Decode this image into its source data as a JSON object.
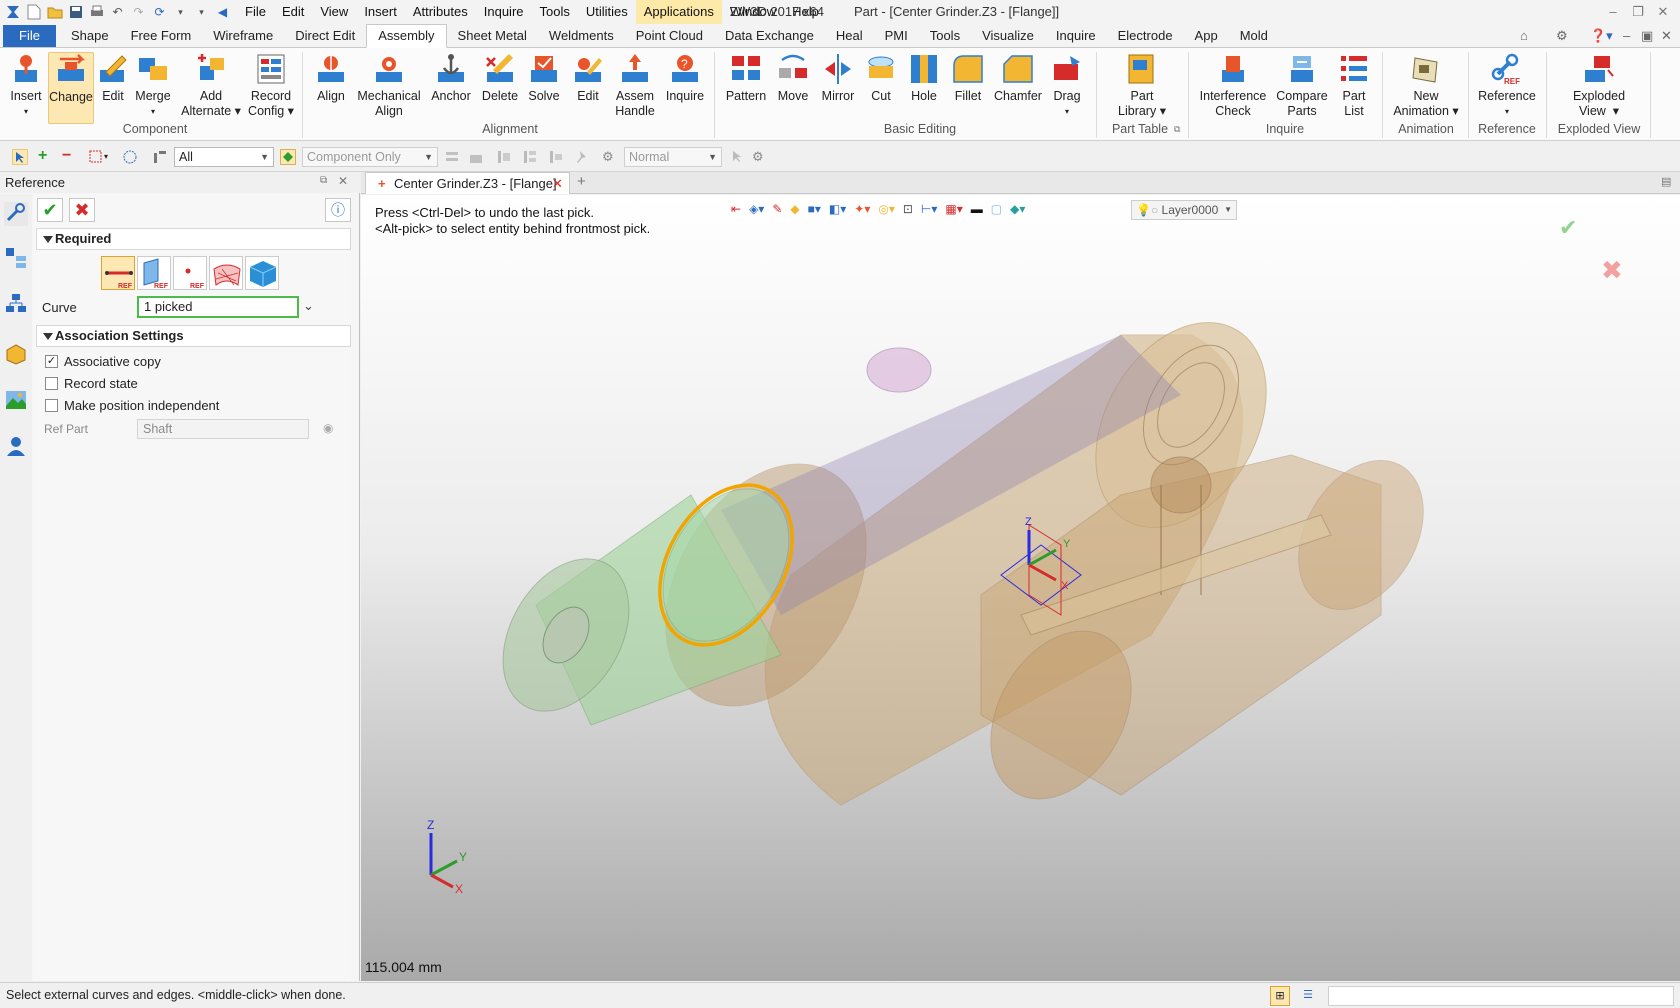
{
  "menu": [
    "File",
    "Edit",
    "View",
    "Insert",
    "Attributes",
    "Inquire",
    "Tools",
    "Utilities",
    "Applications",
    "Window",
    "Help"
  ],
  "window_title": {
    "app": "ZW3D 2017  x64",
    "doc": "Part - [Center Grinder.Z3 - [Flange]]"
  },
  "ribbon_tabs": [
    "Shape",
    "Free Form",
    "Wireframe",
    "Direct Edit",
    "Assembly",
    "Sheet Metal",
    "Weldments",
    "Point Cloud",
    "Data Exchange",
    "Heal",
    "PMI",
    "Tools",
    "Visualize",
    "Inquire",
    "Electrode",
    "App",
    "Mold"
  ],
  "file_tab": "File",
  "ribbon": {
    "component": {
      "group": "Component",
      "insert": "Insert",
      "change": "Change",
      "edit": "Edit",
      "merge": "Merge",
      "add_alt_1": "Add",
      "add_alt_2": "Alternate",
      "record_1": "Record",
      "record_2": "Config"
    },
    "alignment": {
      "group": "Alignment",
      "align": "Align",
      "mech_1": "Mechanical",
      "mech_2": "Align",
      "anchor": "Anchor",
      "delete": "Delete",
      "solve": "Solve",
      "edit": "Edit",
      "assem_1": "Assem",
      "assem_2": "Handle",
      "inquire": "Inquire"
    },
    "basic": {
      "group": "Basic Editing",
      "pattern": "Pattern",
      "move": "Move",
      "mirror": "Mirror",
      "cut": "Cut",
      "hole": "Hole",
      "fillet": "Fillet",
      "chamfer": "Chamfer",
      "drag": "Drag"
    },
    "parttable": {
      "group": "Part Table",
      "lib_1": "Part",
      "lib_2": "Library"
    },
    "inquire": {
      "group": "Inquire",
      "inter_1": "Interference",
      "inter_2": "Check",
      "comp_1": "Compare",
      "comp_2": "Parts",
      "list_1": "Part",
      "list_2": "List"
    },
    "animation": {
      "group": "Animation",
      "new_1": "New",
      "new_2": "Animation"
    },
    "reference": {
      "group": "Reference",
      "ref": "Reference"
    },
    "exploded": {
      "group": "Exploded View",
      "exp_1": "Exploded",
      "exp_2": "View"
    }
  },
  "toolbar": {
    "filter": "All",
    "scope": "Component Only",
    "mode": "Normal"
  },
  "panel": {
    "title": "Reference",
    "required": "Required",
    "curve_label": "Curve",
    "curve_value": "1 picked",
    "assoc": "Association Settings",
    "assoc_copy": "Associative copy",
    "record_state": "Record state",
    "pos_indep": "Make position independent",
    "ref_part_label": "Ref Part",
    "ref_part_value": "Shaft",
    "ref_badge": "REF"
  },
  "doc_tab": "Center Grinder.Z3 - [Flange]",
  "viewport": {
    "hint1": "Press <Ctrl-Del> to undo the last pick.",
    "hint2": "<Alt-pick> to select entity behind frontmost pick.",
    "layer": "Layer0000",
    "measure": "115.004 mm",
    "axis_x": "X",
    "axis_y": "Y",
    "axis_z": "Z"
  },
  "status": "Select external curves and edges.  <middle-click> when done.",
  "colors": {
    "accent": "#2b6bbf",
    "body": "#c9a574",
    "shaft": "#9fd49a",
    "selected_edge": "#f0a500"
  }
}
